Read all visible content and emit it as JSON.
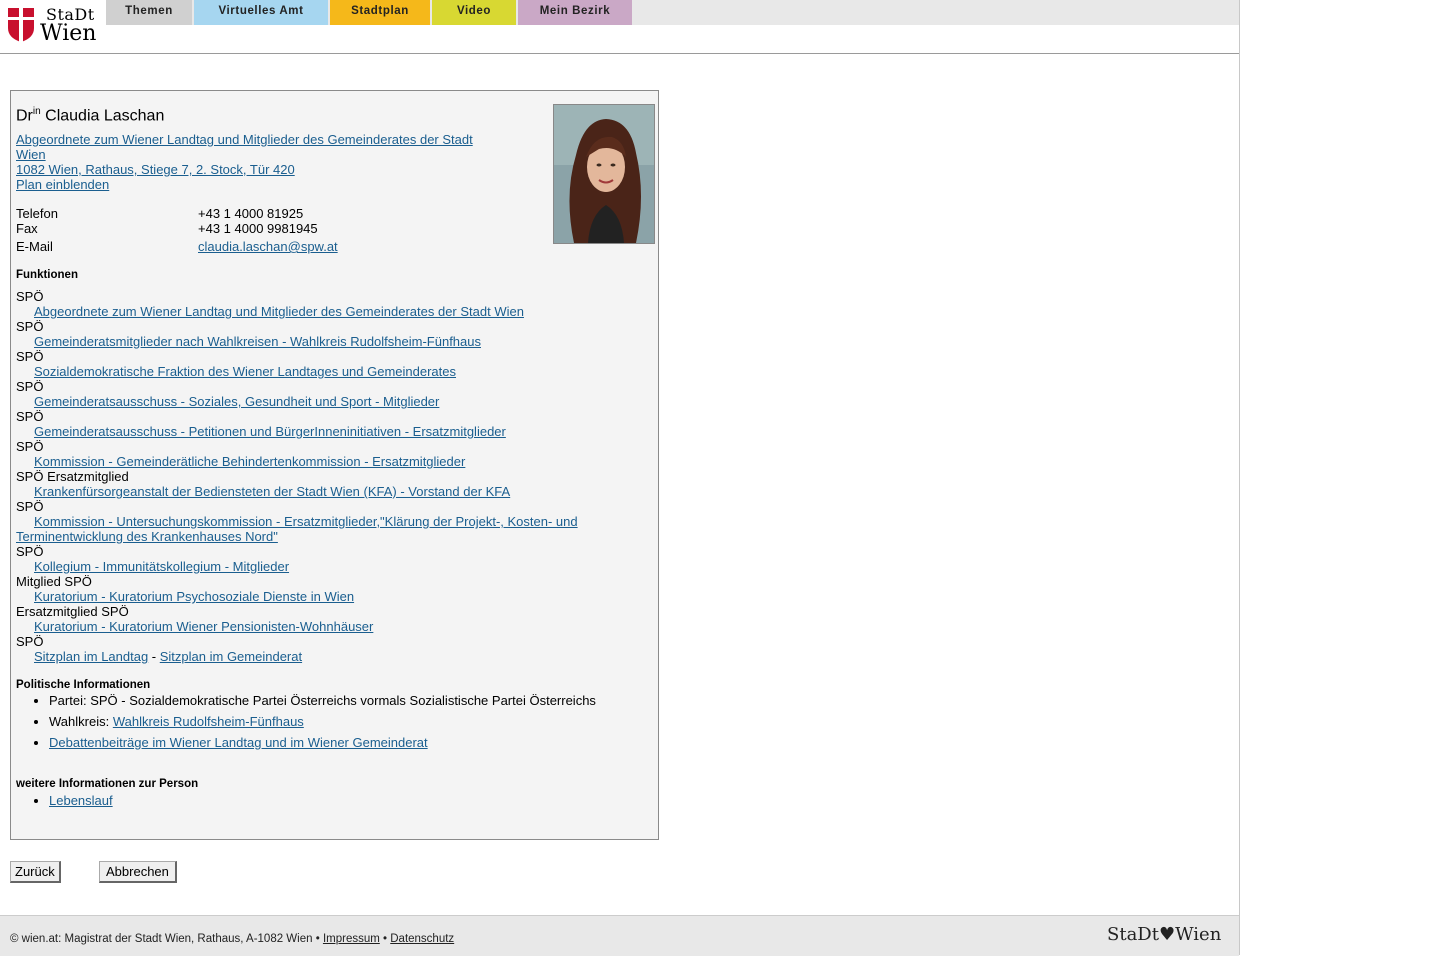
{
  "logo": {
    "line1": "StaDt",
    "line2": "Wien"
  },
  "nav": {
    "tabs": [
      {
        "label": "Themen",
        "color": "#d0d0d0"
      },
      {
        "label": "Virtuelles Amt",
        "color": "#a6d6f0"
      },
      {
        "label": "Stadtplan",
        "color": "#f5b81a"
      },
      {
        "label": "Video",
        "color": "#d8d832"
      },
      {
        "label": "Mein Bezirk",
        "color": "#caa8c6"
      }
    ]
  },
  "person": {
    "title_prefix": "Dr",
    "title_sup": "in",
    "name": "Claudia Laschan",
    "role_line1": "Abgeordnete zum Wiener Landtag und Mitglieder des Gemeinderates der Stadt",
    "role_line2": "Wien",
    "address": "1082 Wien, Rathaus, Stiege 7, 2. Stock, Tür 420",
    "map_link": "Plan einblenden"
  },
  "contact": {
    "phone_label": "Telefon",
    "phone": "+43 1 4000 81925",
    "fax_label": "Fax",
    "fax": "+43 1 4000 9981945",
    "email_label": "E-Mail",
    "email": "claudia.laschan@spw.at"
  },
  "functions": {
    "heading": "Funktionen",
    "items": [
      {
        "party": "SPÖ",
        "link": "Abgeordnete zum Wiener Landtag und Mitglieder des Gemeinderates der Stadt Wien"
      },
      {
        "party": "SPÖ",
        "link": "Gemeinderatsmitglieder nach Wahlkreisen - Wahlkreis Rudolfsheim-Fünfhaus"
      },
      {
        "party": "SPÖ",
        "link": "Sozialdemokratische Fraktion des Wiener Landtages und Gemeinderates"
      },
      {
        "party": "SPÖ",
        "link": "Gemeinderatsausschuss - Soziales, Gesundheit und Sport - Mitglieder"
      },
      {
        "party": "SPÖ",
        "link": "Gemeinderatsausschuss - Petitionen und BürgerInneninitiativen - Ersatzmitglieder"
      },
      {
        "party": "SPÖ",
        "link": "Kommission - Gemeinderätliche Behindertenkommission - Ersatzmitglieder"
      },
      {
        "party": "SPÖ Ersatzmitglied",
        "link": "Krankenfürsorgeanstalt der Bediensteten der Stadt Wien (KFA) - Vorstand der KFA"
      },
      {
        "party": "SPÖ",
        "link": "Kommission - Untersuchungskommission - Ersatzmitglieder,\"Klärung der Projekt-, Kosten- und Terminentwicklung des Krankenhauses Nord\""
      },
      {
        "party": "SPÖ",
        "link": "Kollegium - Immunitätskollegium - Mitglieder"
      },
      {
        "party": "Mitglied SPÖ",
        "link": "Kuratorium - Kuratorium Psychosoziale Dienste in Wien"
      },
      {
        "party": "Ersatzmitglied SPÖ",
        "link": "Kuratorium - Kuratorium Wiener Pensionisten-Wohnhäuser"
      }
    ],
    "last_party": "SPÖ",
    "seat_link1": "Sitzplan im Landtag",
    "seat_sep": " - ",
    "seat_link2": "Sitzplan im Gemeinderat"
  },
  "political": {
    "heading": "Politische Informationen",
    "party_label": "Partei:",
    "party_value": "SPÖ - Sozialdemokratische Partei Österreichs vormals Sozialistische Partei Österreichs",
    "district_label": "Wahlkreis:",
    "district_link": "Wahlkreis Rudolfsheim-Fünfhaus",
    "debate_link": "Debattenbeiträge im Wiener Landtag und im Wiener Gemeinderat"
  },
  "more": {
    "heading": "weitere Informationen zur Person",
    "cv_link": "Lebenslauf"
  },
  "buttons": {
    "back": "Zurück",
    "cancel": "Abbrechen"
  },
  "footer": {
    "text": "© wien.at: Magistrat der Stadt Wien, Rathaus, A-1082 Wien •",
    "impressum": "Impressum",
    "sep": "•",
    "privacy": "Datenschutz",
    "logo": "StaDt♥Wien"
  }
}
